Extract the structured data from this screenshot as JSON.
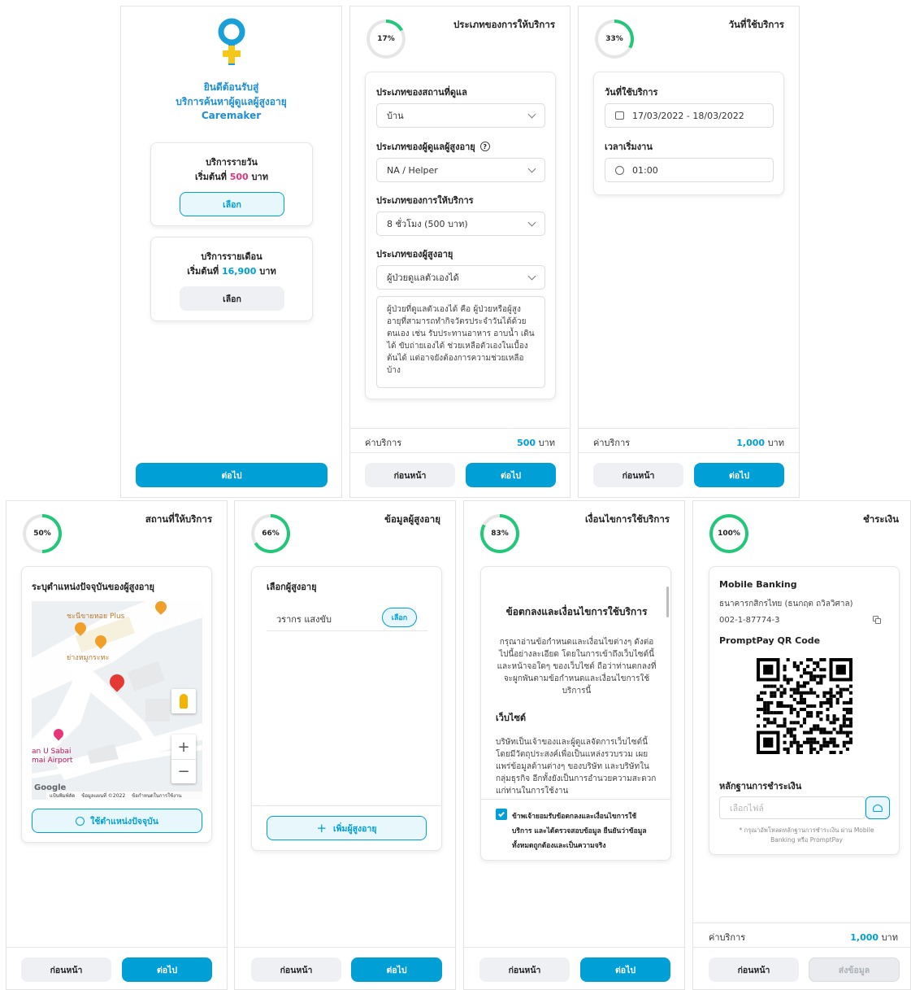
{
  "panel1": {
    "welcome_line1": "ยินดีต้อนรับสู่",
    "welcome_line2": "บริการค้นหาผู้ดูแลผู้สูงอายุ",
    "brand": "Caremaker",
    "daily": {
      "title": "บริการรายวัน",
      "price_prefix": "เริ่มต้นที่",
      "price": "500",
      "unit": "บาท",
      "button": "เลือก"
    },
    "monthly": {
      "title": "บริการรายเดือน",
      "price_prefix": "เริ่มต้นที่",
      "price": "16,900",
      "unit": "บาท",
      "button": "เลือก"
    },
    "next": "ต่อไป"
  },
  "panel2": {
    "progress_label": "17%",
    "progress": 0.17,
    "title": "ประเภทของการให้บริการ",
    "place_label": "ประเภทของสถานที่ดูแล",
    "place_value": "บ้าน",
    "carer_label": "ประเภทของผู้ดูแลผู้สูงอายุ",
    "carer_value": "NA / Helper",
    "service_label": "ประเภทของการให้บริการ",
    "service_value": "8 ชั่วโมง (500 บาท)",
    "elder_label": "ประเภทของผู้สูงอายุ",
    "elder_value": "ผู้ป่วยดูแลตัวเองได้",
    "description": "ผู้ป่วยที่ดูแลตัวเองได้ คือ ผู้ป่วยหรือผู้สูงอายุที่สามารถทำกิจวัตรประจำวันได้ด้วยตนเอง เช่น รับประทานอาหาร อาบน้ำ เดินได้ ขับถ่ายเองได้ ช่วยเหลือตัวเองในเบื้องต้นได้ แต่อาจยังต้องการความช่วยเหลือบ้าง",
    "price_label": "ค่าบริการ",
    "price": "500",
    "unit": "บาท",
    "back": "ก่อนหน้า",
    "next": "ต่อไป"
  },
  "panel3": {
    "progress_label": "33%",
    "progress": 0.33,
    "title": "วันที่ใช้บริการ",
    "date_label": "วันที่ใช้บริการ",
    "date_value": "17/03/2022 - 18/03/2022",
    "time_label": "เวลาเริ่มงาน",
    "time_value": "01:00",
    "price_label": "ค่าบริการ",
    "price": "1,000",
    "unit": "บาท",
    "back": "ก่อนหน้า",
    "next": "ต่อไป"
  },
  "panel4": {
    "progress_label": "50%",
    "progress": 0.5,
    "title": "สถานที่ให้บริการ",
    "card_title": "ระบุตำแหน่งปัจจุบันของผู้สูงอายุ",
    "map_place1": "ชะนีขายหอย Plus",
    "map_place2": "ย่างหมูกระทะ",
    "map_place3_l1": "an U Sabai",
    "map_place3_l2": "mai Airport",
    "map_logo": "Google",
    "map_shortcuts": "แป้นพิมพ์ลัด",
    "map_credit": "ข้อมูลแผนที่ ©2022",
    "map_terms": "ข้อกำหนดในการใช้งาน",
    "use_location": "ใช้ตำแหน่งปัจจุบัน",
    "back": "ก่อนหน้า",
    "next": "ต่อไป"
  },
  "panel5": {
    "progress_label": "66%",
    "progress": 0.66,
    "title": "ข้อมูลผู้สูงอายุ",
    "card_title": "เลือกผู้สูงอายุ",
    "elder_name": "วรากร แสงขับ",
    "select": "เลือก",
    "add": "เพิ่มผู้สูงอายุ",
    "back": "ก่อนหน้า",
    "next": "ต่อไป"
  },
  "panel6": {
    "progress_label": "83%",
    "progress": 0.83,
    "title": "เงื่อนไขการใช้บริการ",
    "terms_heading": "ข้อตกลงและเงื่อนไขการใช้บริการ",
    "terms_intro": "กรุณาอ่านข้อกำหนดและเงื่อนไขต่างๆ ดังต่อไปนี้อย่างละเอียด โดยในการเข้าถึงเว็บไซต์นี้ และหน้าจอใดๆ ของเว็บไซต์ ถือว่าท่านตกลงที่จะผูกพันตามข้อกำหนดและเงื่อนไขการใช้บริการนี้",
    "website_heading": "เว็บไซต์",
    "website_text": "บริษัทเป็นเจ้าของและผู้ดูแลจัดการเว็บไซต์นี้ โดยมีวัตถุประสงค์เพื่อเป็นแหล่งรวบรวม เผยแพร่ข้อมูลด้านต่างๆ ของบริษัท และบริษัทในกลุ่มธุรกิจ อีกทั้งยังเป็นการอำนวยความสะดวกแก่ท่านในการใช้งาน",
    "consent_l1": "ข้าพเจ้ายอมรับข้อตกลงและเงื่อนไขการใช้",
    "consent_l2": "บริการ และได้ตรวจสอบข้อมูล ยืนยันว่าข้อมูล",
    "consent_l3": "ทั้งหมดถูกต้องและเป็นความจริง",
    "back": "ก่อนหน้า",
    "next": "ต่อไป"
  },
  "panel7": {
    "progress_label": "100%",
    "progress": 1.0,
    "title": "ชำระเงิน",
    "bank_heading": "Mobile Banking",
    "bank_name": "ธนาคารกสิกรไทย (ธนกฤต ถวิลวิศาล)",
    "account": "002-1-87774-3",
    "qr_heading": "PromptPay QR Code",
    "evidence_heading": "หลักฐานการชำระเงิน",
    "file_placeholder": "เลือกไฟล์",
    "note": "* กรุณาอัพโหลดหลักฐานการชำระเงิน ผ่าน Mobile Banking หรือ PromptPay",
    "price_label": "ค่าบริการ",
    "price": "1,000",
    "unit": "บาท",
    "back": "ก่อนหน้า",
    "submit": "ส่งข้อมูล"
  },
  "colors": {
    "accent": "#009fd6",
    "progress": "#22c77a",
    "pink": "#e8357a"
  }
}
